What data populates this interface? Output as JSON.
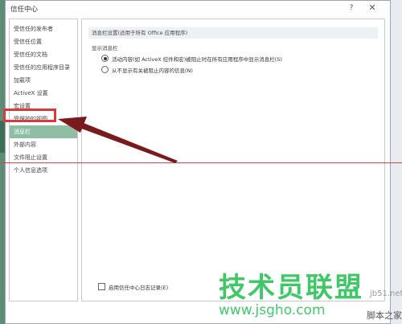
{
  "dialog": {
    "title": "信任中心",
    "help_glyph": "?",
    "close_glyph": "✕"
  },
  "sidebar": {
    "items": [
      {
        "label": "受信任的发布者"
      },
      {
        "label": "受信任位置"
      },
      {
        "label": "受信任的文档"
      },
      {
        "label": "受信任的应用程序目录"
      },
      {
        "label": "加载项"
      },
      {
        "label": "ActiveX 设置"
      },
      {
        "label": "宏设置"
      },
      {
        "label": "受保护的视图"
      },
      {
        "label": "消息栏"
      },
      {
        "label": "外部内容"
      },
      {
        "label": "文件阻止设置"
      },
      {
        "label": "个人信息选项"
      }
    ],
    "selected_index": 8
  },
  "main": {
    "section_header": "消息栏设置(适用于所有 Office 应用程序)",
    "group_label": "显示消息栏",
    "radio_options": [
      {
        "label": "活动内容(如 ActiveX 控件和宏)被阻止时在所有应用程序中显示消息栏(S)",
        "checked": true
      },
      {
        "label": "从不显示有关被阻止内容的信息(N)",
        "checked": false
      }
    ],
    "log_checkbox": {
      "label": "启用信任中心日志记录(E)",
      "checked": false
    }
  },
  "watermark": {
    "logo_text": "技术员联盟",
    "url_text": "www.jsgho.com",
    "corner_text": "脚本之家",
    "corner_url": "jb51.net"
  },
  "colors": {
    "selected_item": "#8fbea4",
    "highlight_box": "#d63a3a",
    "arrow": "#7a1a1a",
    "guide_line": "#d7434b",
    "watermark": "#2ec45a"
  },
  "icons": [
    "help-icon",
    "close-icon",
    "arrow-annotation"
  ]
}
